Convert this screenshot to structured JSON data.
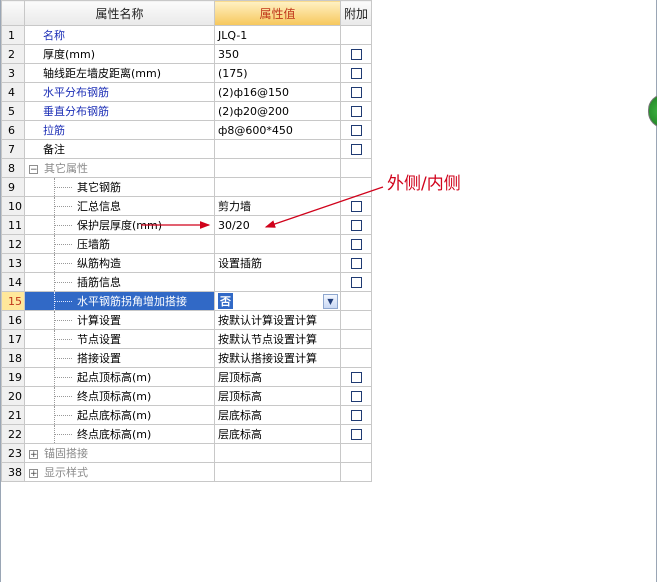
{
  "header": {
    "num_col": "",
    "name_col": "属性名称",
    "value_col": "属性值",
    "extra_col": "附加"
  },
  "rows": [
    {
      "num": "1",
      "name": "名称",
      "value": "JLQ-1",
      "check": false,
      "style": "blue"
    },
    {
      "num": "2",
      "name": "厚度(mm)",
      "value": "350",
      "check": true,
      "style": "normal"
    },
    {
      "num": "3",
      "name": "轴线距左墙皮距离(mm)",
      "value": "(175)",
      "check": true,
      "style": "normal"
    },
    {
      "num": "4",
      "name": "水平分布钢筋",
      "value": "(2)ф16@150",
      "check": true,
      "style": "blue"
    },
    {
      "num": "5",
      "name": "垂直分布钢筋",
      "value": "(2)ф20@200",
      "check": true,
      "style": "blue"
    },
    {
      "num": "6",
      "name": "拉筋",
      "value": "ф8@600*450",
      "check": true,
      "style": "blue"
    },
    {
      "num": "7",
      "name": "备注",
      "value": "",
      "check": true,
      "style": "normal"
    },
    {
      "num": "8",
      "name": "其它属性",
      "value": "",
      "check": false,
      "style": "group-open"
    },
    {
      "num": "9",
      "name": "其它钢筋",
      "value": "",
      "check": false,
      "style": "child"
    },
    {
      "num": "10",
      "name": "汇总信息",
      "value": "剪力墙",
      "check": true,
      "style": "child"
    },
    {
      "num": "11",
      "name": "保护层厚度(mm)",
      "value": "30/20",
      "check": true,
      "style": "child"
    },
    {
      "num": "12",
      "name": "压墙筋",
      "value": "",
      "check": true,
      "style": "child"
    },
    {
      "num": "13",
      "name": "纵筋构造",
      "value": "设置插筋",
      "check": true,
      "style": "child"
    },
    {
      "num": "14",
      "name": "插筋信息",
      "value": "",
      "check": true,
      "style": "child"
    },
    {
      "num": "15",
      "name": "水平钢筋拐角增加搭接",
      "value": "否",
      "check": false,
      "style": "selected"
    },
    {
      "num": "16",
      "name": "计算设置",
      "value": "按默认计算设置计算",
      "check": false,
      "style": "child"
    },
    {
      "num": "17",
      "name": "节点设置",
      "value": "按默认节点设置计算",
      "check": false,
      "style": "child"
    },
    {
      "num": "18",
      "name": "搭接设置",
      "value": "按默认搭接设置计算",
      "check": false,
      "style": "child"
    },
    {
      "num": "19",
      "name": "起点顶标高(m)",
      "value": "层顶标高",
      "check": true,
      "style": "child"
    },
    {
      "num": "20",
      "name": "终点顶标高(m)",
      "value": "层顶标高",
      "check": true,
      "style": "child"
    },
    {
      "num": "21",
      "name": "起点底标高(m)",
      "value": "层底标高",
      "check": true,
      "style": "child"
    },
    {
      "num": "22",
      "name": "终点底标高(m)",
      "value": "层底标高",
      "check": true,
      "style": "child"
    },
    {
      "num": "23",
      "name": "锚固搭接",
      "value": "",
      "check": false,
      "style": "group-closed"
    },
    {
      "num": "38",
      "name": "显示样式",
      "value": "",
      "check": false,
      "style": "group-closed"
    }
  ],
  "annotation": {
    "text": "外侧/内侧",
    "color": "#d0021b"
  },
  "icons": {
    "dropdown": "chevron-down-icon",
    "expand": "plus-icon",
    "collapse": "minus-icon"
  }
}
